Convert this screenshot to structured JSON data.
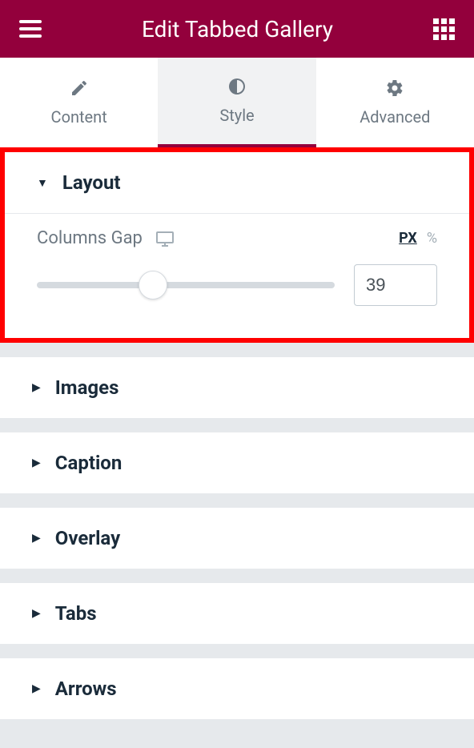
{
  "header": {
    "title": "Edit Tabbed Gallery"
  },
  "tabs": {
    "content": {
      "label": "Content"
    },
    "style": {
      "label": "Style"
    },
    "advanced": {
      "label": "Advanced"
    }
  },
  "sections": {
    "layout": {
      "title": "Layout",
      "controls": {
        "columns_gap": {
          "label": "Columns Gap",
          "units": {
            "px": "PX",
            "pct": "%"
          },
          "value": "39",
          "slider_percent": 39
        }
      }
    },
    "images": {
      "title": "Images"
    },
    "caption": {
      "title": "Caption"
    },
    "overlay": {
      "title": "Overlay"
    },
    "tabs": {
      "title": "Tabs"
    },
    "arrows": {
      "title": "Arrows"
    }
  }
}
